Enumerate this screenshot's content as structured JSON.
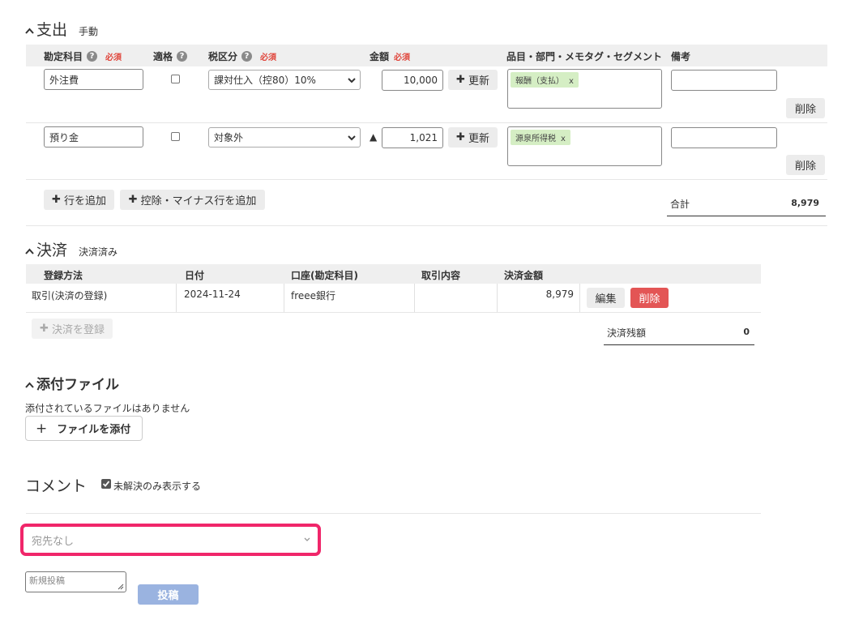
{
  "expense": {
    "title": "支出",
    "subtitle": "手動",
    "headers": {
      "account": "勘定科目",
      "eligible": "適格",
      "tax": "税区分",
      "amount": "金額",
      "items": "品目・部門・メモタグ・セグメント",
      "note": "備考",
      "required": "必須"
    },
    "rows": [
      {
        "account": "外注費",
        "tax": "課対仕入（控80）10%",
        "amount": "10,000",
        "update": "更新",
        "tag": "報酬（支払）",
        "tag_remove": "x",
        "delete": "削除"
      },
      {
        "account": "預り金",
        "tax": "対象外",
        "amount": "1,021",
        "update": "更新",
        "tag": "源泉所得税",
        "tag_remove": "x",
        "delete": "削除",
        "direction": "▲"
      }
    ],
    "add_row": "行を追加",
    "add_minus_row": "控除・マイナス行を追加",
    "total_label": "合計",
    "total_value": "8,979"
  },
  "settlement": {
    "title": "決済",
    "subtitle": "決済済み",
    "headers": {
      "method": "登録方法",
      "date": "日付",
      "account": "口座(勘定科目)",
      "content": "取引内容",
      "amount": "決済金額"
    },
    "row": {
      "method": "取引(決済の登録)",
      "date": "2024-11-24",
      "account": "freee銀行",
      "content": "",
      "amount": "8,979",
      "edit": "編集",
      "delete": "削除"
    },
    "register": "決済を登録",
    "balance_label": "決済残額",
    "balance_value": "0"
  },
  "attachments": {
    "title": "添付ファイル",
    "empty": "添付されているファイルはありません",
    "add": "ファイルを添付"
  },
  "comments": {
    "title": "コメント",
    "unresolved_only": "未解決のみ表示する",
    "destination": "宛先なし",
    "new_post_placeholder": "新規投稿",
    "post": "投稿"
  },
  "colors": {
    "highlight": "#f0266a",
    "tag_bg": "#d5eec4",
    "delete_red": "#e35555",
    "post_blue": "#9ab3e0",
    "required_red": "#e0463c"
  }
}
